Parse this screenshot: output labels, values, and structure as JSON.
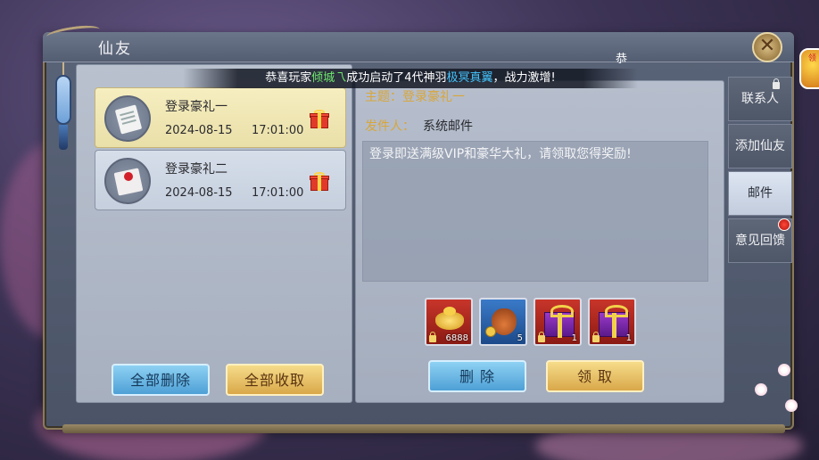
{
  "window": {
    "title": "仙友",
    "close_icon": "✕",
    "stray_text": "恭"
  },
  "broadcast": {
    "prefix": "恭喜玩家",
    "player": "倾城乁",
    "middle": "成功启动了4代神羽",
    "item": "极冥真翼",
    "suffix": "，战力激增!"
  },
  "mail_list": [
    {
      "name": "登录豪礼一",
      "date": "2024-08-15",
      "time": "17:01:00",
      "icon": "letter-icon",
      "selected": true
    },
    {
      "name": "登录豪礼二",
      "date": "2024-08-15",
      "time": "17:01:00",
      "icon": "envelope-icon",
      "selected": false
    }
  ],
  "left_buttons": {
    "delete_all": "全部删除",
    "collect_all": "全部收取"
  },
  "detail": {
    "subject": "主题：登录豪礼一",
    "sender_label": "发件人：",
    "sender_value": "系统邮件",
    "body": "登录即送满级VIP和豪华大礼，请领取您得奖励!"
  },
  "rewards": [
    {
      "icon": "gold-ingot-icon",
      "count": "6888",
      "style": "red"
    },
    {
      "icon": "money-bag-icon",
      "count": "5",
      "style": "blue"
    },
    {
      "icon": "purple-gift-box-icon",
      "count": "1",
      "style": "red"
    },
    {
      "icon": "purple-gift-box-icon",
      "count": "1",
      "style": "red"
    }
  ],
  "detail_buttons": {
    "delete": "删 除",
    "collect": "领 取"
  },
  "tabs": [
    {
      "label": "联系人",
      "active": false
    },
    {
      "label": "添加仙友",
      "active": false
    },
    {
      "label": "邮件",
      "active": true
    },
    {
      "label": "意见回馈",
      "active": false
    }
  ],
  "corner_badge": "领"
}
